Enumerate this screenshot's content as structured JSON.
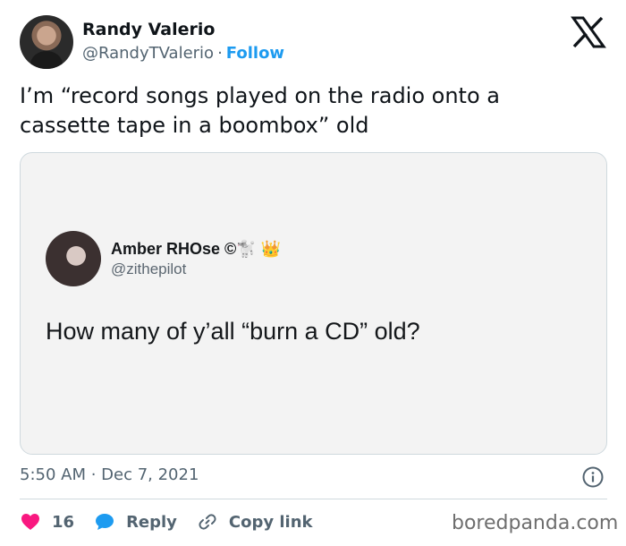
{
  "author": {
    "name": "Randy Valerio",
    "handle": "@RandyTValerio",
    "separator": "·",
    "follow_label": "Follow"
  },
  "tweet": {
    "text": "I’m “record songs played on the radio onto a cassette tape in a boombox” old",
    "timestamp": "5:50 AM · Dec 7, 2021"
  },
  "embedded": {
    "name": "Amber RHOse ©🐩 👑",
    "handle": "@zithepilot",
    "text": "How many of y’all “burn a CD” old?"
  },
  "actions": {
    "likes": "16",
    "reply_label": "Reply",
    "copy_label": "Copy link"
  },
  "watermark": "boredpanda.com",
  "colors": {
    "like": "#f91880",
    "reply": "#1d9bf0",
    "follow": "#1d9bf0"
  }
}
